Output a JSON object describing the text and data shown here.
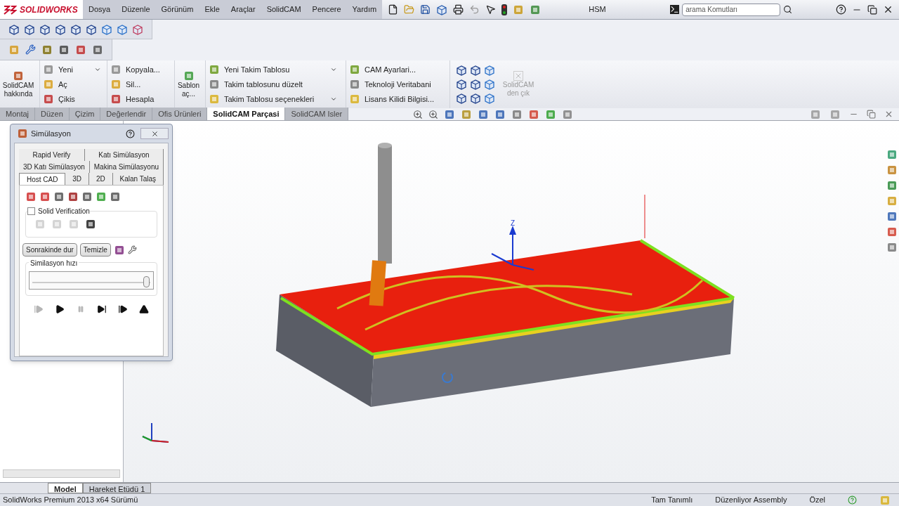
{
  "title_bar": {
    "logo": "SOLIDWORKS",
    "menu": [
      "Dosya",
      "Düzenle",
      "Görünüm",
      "Ekle",
      "Araçlar",
      "SolidCAM",
      "Pencere",
      "Yardım"
    ],
    "document_title": "HSM",
    "search": {
      "placeholder": "arama Komutları"
    }
  },
  "command_manager": {
    "about": "SolidCAM hakkında",
    "columns": [
      [
        {
          "label": "Yeni",
          "has_menu": true
        },
        {
          "label": "Aç",
          "has_menu": false
        },
        {
          "label": "Çikis",
          "has_menu": false
        }
      ],
      [
        {
          "label": "Kopyala...",
          "has_menu": false
        },
        {
          "label": "Sil...",
          "has_menu": false
        },
        {
          "label": "Hesapla",
          "has_menu": false
        }
      ]
    ],
    "template": "Sablon aç...",
    "tool_columns": [
      [
        {
          "label": "Yeni Takim Tablosu",
          "has_menu": true
        },
        {
          "label": "Takim tablosunu düzelt",
          "has_menu": false
        },
        {
          "label": "Takim Tablosu seçenekleri",
          "has_menu": true
        }
      ],
      [
        {
          "label": "CAM Ayarlari...",
          "has_menu": false
        },
        {
          "label": "Teknoloji Veritabani",
          "has_menu": false
        },
        {
          "label": "Lisans Kilidi Bilgisi...",
          "has_menu": false
        }
      ]
    ],
    "exit": {
      "label": "SolidCAM den çık",
      "disabled": true
    }
  },
  "command_tabs": [
    {
      "label": "Montaj",
      "selected": false
    },
    {
      "label": "Düzen",
      "selected": false
    },
    {
      "label": "Çizim",
      "selected": false
    },
    {
      "label": "Değerlendir",
      "selected": false
    },
    {
      "label": "Ofis Ürünleri",
      "selected": false
    },
    {
      "label": "SolidCAM Parçasi",
      "selected": true
    },
    {
      "label": "SolidCAM Isler",
      "selected": false
    }
  ],
  "simulation": {
    "title": "Simülasyon",
    "tab_rows": [
      [
        {
          "label": "Rapid Verify",
          "selected": false
        },
        {
          "label": "Katı Simülasyon",
          "selected": false
        }
      ],
      [
        {
          "label": "3D Katı Simülasyon",
          "selected": false
        },
        {
          "label": "Makina Simülasyonu",
          "selected": false
        }
      ],
      [
        {
          "label": "Host CAD",
          "selected": true
        },
        {
          "label": "3D",
          "selected": false
        },
        {
          "label": "2D",
          "selected": false
        },
        {
          "label": "Kalan Talaş",
          "selected": false
        }
      ]
    ],
    "solid_verification": {
      "label": "Solid Verification",
      "checked": false
    },
    "buttons": [
      "Sonrakinde dur",
      "Temizle"
    ],
    "speed": {
      "label": "Similasyon hızı",
      "level": 0.97
    },
    "controls": [
      {
        "kind": "step-back",
        "disabled": true
      },
      {
        "kind": "play",
        "disabled": false
      },
      {
        "kind": "pause",
        "disabled": true
      },
      {
        "kind": "step",
        "disabled": false
      },
      {
        "kind": "run-to-end",
        "disabled": false
      },
      {
        "kind": "eject",
        "disabled": false
      }
    ]
  },
  "viewport": {
    "axis_label": "Z"
  },
  "bottom_tabs": [
    {
      "label": "Model",
      "selected": true
    },
    {
      "label": "Hareket Etüdü 1",
      "selected": false
    }
  ],
  "status_bar": {
    "left": "SolidWorks Premium 2013 x64 Sürümü",
    "right": [
      "Tam Tanımlı",
      "Düzenliyor Assembly",
      "Özel"
    ]
  }
}
